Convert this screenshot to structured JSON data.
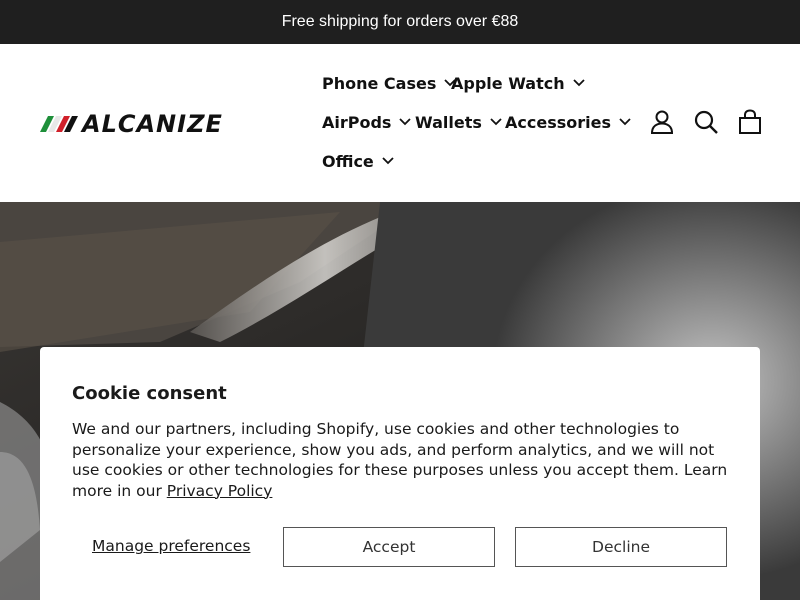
{
  "announcement": {
    "text": "Free shipping for orders over €88"
  },
  "brand": {
    "name": "ALCANIZE",
    "flag_colors": [
      "#1e8f3a",
      "#ffffff",
      "#d0202a"
    ]
  },
  "nav": {
    "items": [
      {
        "label": "Phone Cases"
      },
      {
        "label": "Apple Watch"
      },
      {
        "label": "AirPods"
      },
      {
        "label": "Wallets"
      },
      {
        "label": "Accessories"
      },
      {
        "label": "Office"
      }
    ]
  },
  "header_icons": [
    "user-icon",
    "search-icon",
    "cart-icon"
  ],
  "cookie": {
    "title": "Cookie consent",
    "body": "We and our partners, including Shopify, use cookies and other technologies to personalize your experience, show you ads, and perform analytics, and we will not use cookies or other technologies for these purposes unless you accept them. Learn more in our ",
    "privacy_link": "Privacy Policy",
    "manage_label": "Manage preferences",
    "accept_label": "Accept",
    "decline_label": "Decline"
  }
}
